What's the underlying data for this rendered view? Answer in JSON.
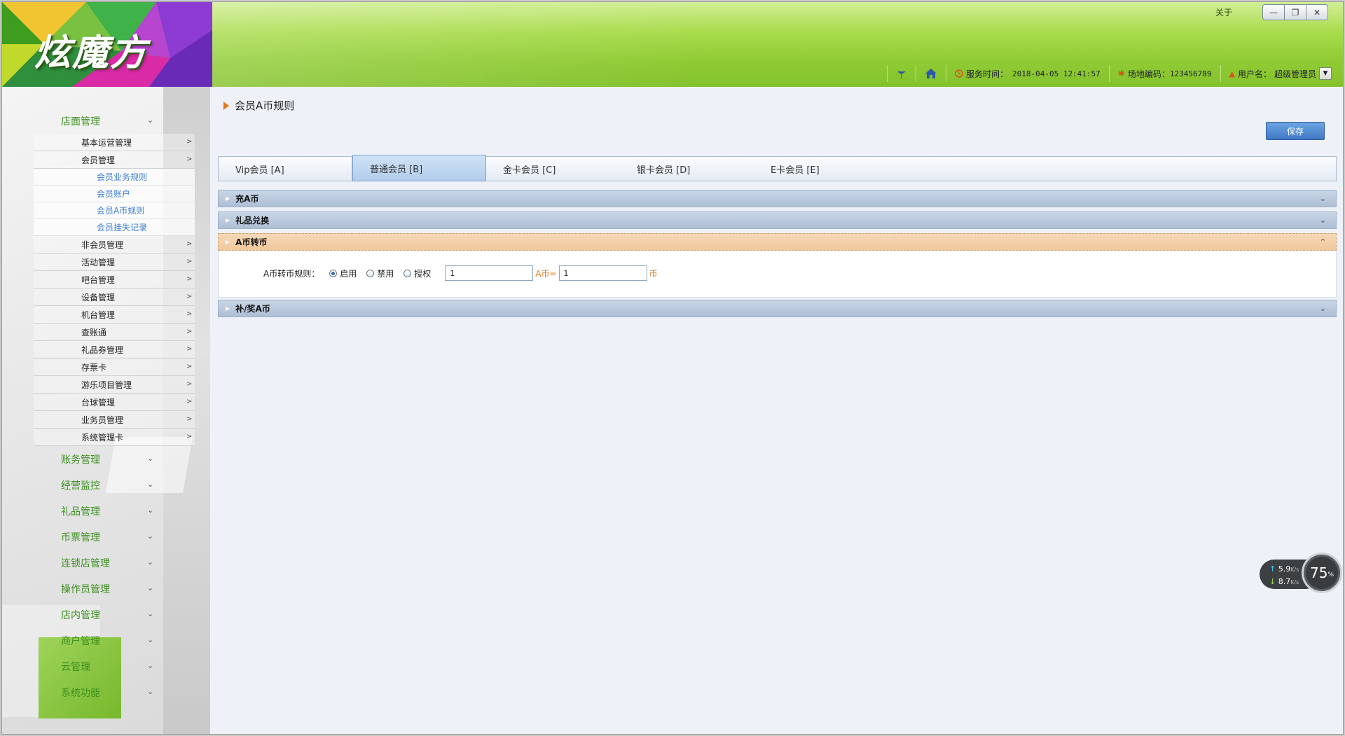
{
  "header": {
    "logo_text": "炫魔方",
    "about_label": "关于",
    "service_time_label": "服务时间：",
    "service_time_value": "2018-04-05 12:41:57",
    "site_code_label": "场地编码：",
    "site_code_value": "123456789",
    "username_label": "用户名：",
    "username_value": "超级管理员",
    "accent_color": "#8fcb34"
  },
  "sidebar": {
    "store_mgmt": "店面管理",
    "store_sub": [
      "基本运营管理",
      "会员管理"
    ],
    "member_sub": [
      "会员业务规则",
      "会员账户",
      "会员A币规则",
      "会员挂失记录"
    ],
    "store_sub_rest": [
      "非会员管理",
      "活动管理",
      "吧台管理",
      "设备管理",
      "机台管理",
      "查账通",
      "礼品券管理",
      "存票卡",
      "游乐项目管理",
      "台球管理",
      "业务员管理",
      "系统管理卡"
    ],
    "top_items": [
      "账务管理",
      "经营监控",
      "礼品管理",
      "币票管理",
      "连锁店管理",
      "操作员管理",
      "店内管理",
      "商户管理",
      "云管理",
      "系统功能"
    ]
  },
  "main": {
    "page_title": "会员A币规则",
    "save_label": "保存",
    "tabs": [
      "Vip会员 [A]",
      "普通会员 [B]",
      "金卡会员 [C]",
      "银卡会员 [D]",
      "E卡会员 [E]"
    ],
    "sections": {
      "recharge": "充A币",
      "gift": "礼品兑换",
      "transfer": "A币转币",
      "bonus": "补/奖A币"
    },
    "rule": {
      "label": "A币转币规则：",
      "options": [
        "启用",
        "禁用",
        "授权"
      ],
      "selected": "启用",
      "value_a": "1",
      "a_suffix": "A币=",
      "value_b": "1",
      "b_suffix": "币"
    }
  },
  "netspeed": {
    "up": "5.9",
    "down": "8.7",
    "unit": "K/s",
    "percent": "75",
    "percent_unit": "%"
  }
}
